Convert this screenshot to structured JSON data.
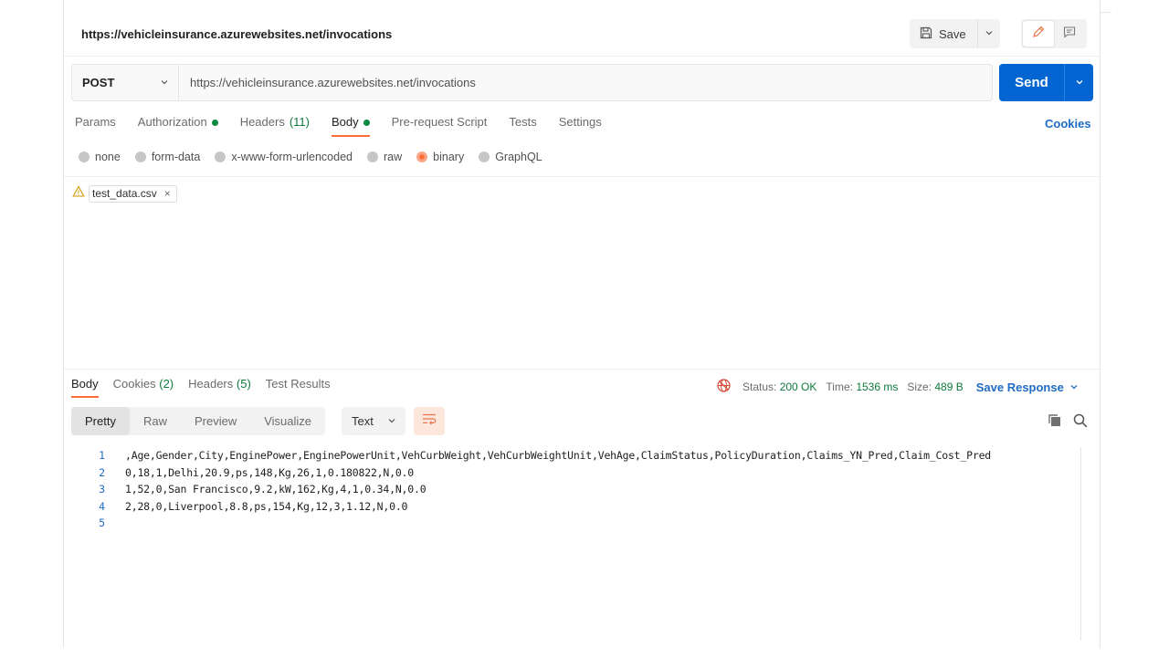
{
  "request": {
    "title": "https://vehicleinsurance.azurewebsites.net/invocations",
    "save_label": "Save",
    "method": "POST",
    "url": "https://vehicleinsurance.azurewebsites.net/invocations",
    "send_label": "Send",
    "tabs": [
      {
        "label": "Params"
      },
      {
        "label": "Authorization"
      },
      {
        "label": "Headers",
        "count": "(11)"
      },
      {
        "label": "Body"
      },
      {
        "label": "Pre-request Script"
      },
      {
        "label": "Tests"
      },
      {
        "label": "Settings"
      }
    ],
    "active_tab": "Body",
    "cookies_label": "Cookies",
    "body_types": [
      "none",
      "form-data",
      "x-www-form-urlencoded",
      "raw",
      "binary",
      "GraphQL"
    ],
    "selected_body_type": "binary",
    "file_name": "test_data.csv",
    "file_remove": "×"
  },
  "response": {
    "tabs": [
      {
        "label": "Body"
      },
      {
        "label": "Cookies",
        "count": "(2)"
      },
      {
        "label": "Headers",
        "count": "(5)"
      },
      {
        "label": "Test Results"
      }
    ],
    "status_label": "Status:",
    "status_value": "200 OK",
    "time_label": "Time:",
    "time_value": "1536 ms",
    "size_label": "Size:",
    "size_value": "489 B",
    "save_response_label": "Save Response",
    "view_modes": [
      "Pretty",
      "Raw",
      "Preview",
      "Visualize"
    ],
    "active_view": "Pretty",
    "format": "Text",
    "lines": [
      {
        "n": "1",
        "text": ",Age,Gender,City,EnginePower,EnginePowerUnit,VehCurbWeight,VehCurbWeightUnit,VehAge,ClaimStatus,PolicyDuration,Claims_YN_Pred,Claim_Cost_Pred"
      },
      {
        "n": "2",
        "text": "0,18,1,Delhi,20.9,ps,148,Kg,26,1,0.180822,N,0.0"
      },
      {
        "n": "3",
        "text": "1,52,0,San Francisco,9.2,kW,162,Kg,4,1,0.34,N,0.0"
      },
      {
        "n": "4",
        "text": "2,28,0,Liverpool,8.8,ps,154,Kg,12,3,1.12,N,0.0"
      },
      {
        "n": "5",
        "text": ""
      }
    ]
  },
  "colors": {
    "accent_orange": "#ff6c37",
    "send_blue": "#0265d2",
    "link_blue": "#1f6bc6",
    "status_green": "#0d7a3a"
  },
  "icons": {
    "save": "floppy-disk-icon",
    "edit": "pencil-icon",
    "comments": "comment-icon",
    "warning": "warning-triangle-icon",
    "globe": "globe-blocked-icon",
    "copy": "copy-icon",
    "search": "search-icon",
    "wrap": "wrap-lines-icon"
  }
}
